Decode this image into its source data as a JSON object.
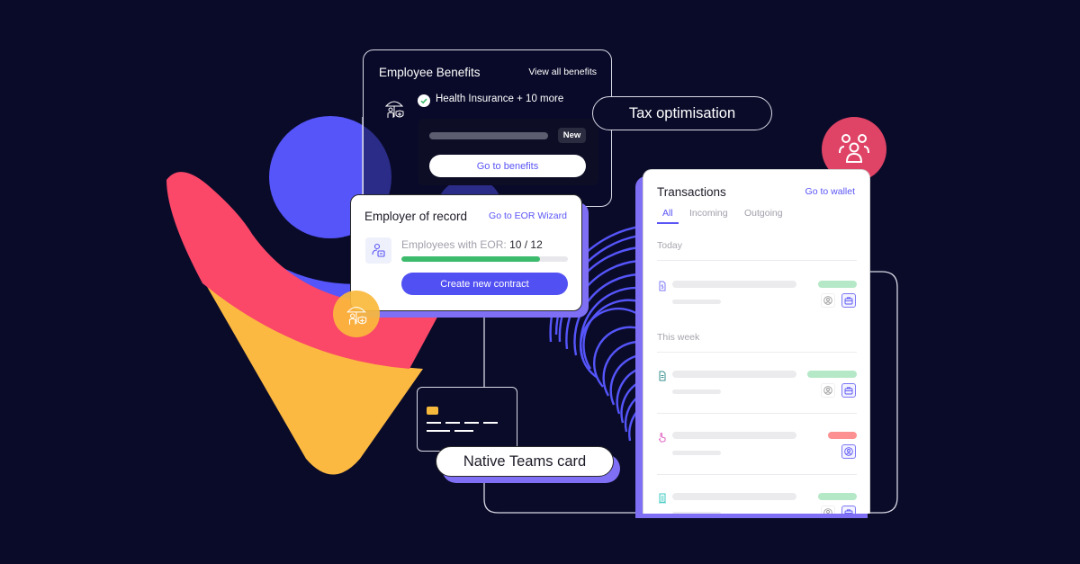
{
  "colors": {
    "background": "#0a0b29",
    "accent": "#5a55f5",
    "shadow_purple": "#7e6ff5",
    "pink": "#fb4768",
    "yellow": "#fcb941",
    "green": "#3cbb6d",
    "amount_positive": "#b5e8c7",
    "amount_negative": "#fd9191"
  },
  "benefits_card": {
    "title": "Employee Benefits",
    "view_all_label": "View all benefits",
    "icon": "umbrella-insurance-icon",
    "item_label": "Health Insurance + 10 more",
    "badge": "New",
    "button_label": "Go to benefits"
  },
  "tax_pill": {
    "label": "Tax optimisation"
  },
  "eor_card": {
    "title": "Employer of record",
    "link_label": "Go to EOR Wizard",
    "employees_label": "Employees with EOR:",
    "employees_value": "10 / 12",
    "progress": 0.83,
    "button_label": "Create new contract"
  },
  "native_card": {
    "label": "Native Teams card"
  },
  "transactions": {
    "title": "Transactions",
    "link_label": "Go to wallet",
    "tabs": [
      {
        "label": "All",
        "active": true
      },
      {
        "label": "Incoming",
        "active": false
      },
      {
        "label": "Outgoing",
        "active": false
      }
    ],
    "sections": [
      {
        "label": "Today"
      },
      {
        "label": "This week"
      }
    ],
    "rows": [
      {
        "icon": "invoice-icon",
        "status": "positive",
        "actions": [
          "user-icon",
          "briefcase-icon"
        ]
      },
      {
        "icon": "document-icon",
        "status": "positive",
        "actions": [
          "user-icon",
          "briefcase-icon"
        ]
      },
      {
        "icon": "hand-pointer-icon",
        "status": "negative",
        "actions": [
          "user-icon"
        ]
      },
      {
        "icon": "receipt-icon",
        "status": "positive",
        "actions": [
          "user-icon",
          "briefcase-icon"
        ]
      }
    ]
  }
}
